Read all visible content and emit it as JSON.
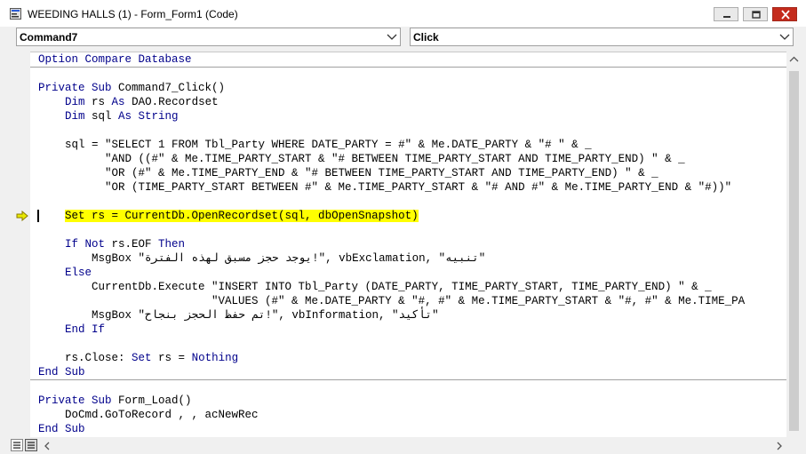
{
  "window": {
    "title": "WEEDING HALLS (1) - Form_Form1 (Code)"
  },
  "object_combo": {
    "value": "Command7"
  },
  "procedure_combo": {
    "value": "Click"
  },
  "code": {
    "declarations": [
      [
        {
          "t": "Option Compare Database",
          "k": true
        }
      ]
    ],
    "proc1": [
      [
        {
          "t": "Private Sub",
          "k": true
        },
        {
          "t": " Command7_Click()"
        }
      ],
      [
        {
          "t": "    "
        },
        {
          "t": "Dim",
          "k": true
        },
        {
          "t": " rs "
        },
        {
          "t": "As",
          "k": true
        },
        {
          "t": " DAO.Recordset"
        }
      ],
      [
        {
          "t": "    "
        },
        {
          "t": "Dim",
          "k": true
        },
        {
          "t": " sql "
        },
        {
          "t": "As String",
          "k": true
        }
      ],
      [
        {
          "t": ""
        }
      ],
      [
        {
          "t": "    sql = \"SELECT 1 FROM Tbl_Party WHERE DATE_PARTY = #\" & Me.DATE_PARTY & \"# \" & _"
        }
      ],
      [
        {
          "t": "          \"AND ((#\" & Me.TIME_PARTY_START & \"# BETWEEN TIME_PARTY_START AND TIME_PARTY_END) \" & _"
        }
      ],
      [
        {
          "t": "          \"OR (#\" & Me.TIME_PARTY_END & \"# BETWEEN TIME_PARTY_START AND TIME_PARTY_END) \" & _"
        }
      ],
      [
        {
          "t": "          \"OR (TIME_PARTY_START BETWEEN #\" & Me.TIME_PARTY_START & \"# AND #\" & Me.TIME_PARTY_END & \"#))\""
        }
      ],
      [
        {
          "t": ""
        }
      ],
      [
        {
          "t": "    "
        },
        {
          "t": "Set rs = CurrentDb.OpenRecordset(sql, dbOpenSnapshot)",
          "h": true
        }
      ],
      [
        {
          "t": ""
        }
      ],
      [
        {
          "t": "    "
        },
        {
          "t": "If Not",
          "k": true
        },
        {
          "t": " rs.EOF "
        },
        {
          "t": "Then",
          "k": true
        }
      ],
      [
        {
          "t": "        MsgBox \"يوجد حجز مسبق لهذه الفترة!\", vbExclamation, \"تنبيه\""
        }
      ],
      [
        {
          "t": "    "
        },
        {
          "t": "Else",
          "k": true
        }
      ],
      [
        {
          "t": "        CurrentDb.Execute \"INSERT INTO Tbl_Party (DATE_PARTY, TIME_PARTY_START, TIME_PARTY_END) \" & _"
        }
      ],
      [
        {
          "t": "                          \"VALUES (#\" & Me.DATE_PARTY & \"#, #\" & Me.TIME_PARTY_START & \"#, #\" & Me.TIME_PA"
        }
      ],
      [
        {
          "t": "        MsgBox \"تم حفظ الحجز بنجاح!\", vbInformation, \"تأكيد\""
        }
      ],
      [
        {
          "t": "    "
        },
        {
          "t": "End If",
          "k": true
        }
      ],
      [
        {
          "t": ""
        }
      ],
      [
        {
          "t": "    rs.Close: "
        },
        {
          "t": "Set",
          "k": true
        },
        {
          "t": " rs = "
        },
        {
          "t": "Nothing",
          "k": true
        }
      ],
      [
        {
          "t": "End Sub",
          "k": true
        }
      ]
    ],
    "proc2": [
      [
        {
          "t": "Private Sub",
          "k": true
        },
        {
          "t": " Form_Load()"
        }
      ],
      [
        {
          "t": "    DoCmd.GoToRecord , , acNewRec"
        }
      ],
      [
        {
          "t": "End Sub",
          "k": true
        }
      ]
    ]
  },
  "colors": {
    "keyword": "#00008b",
    "highlight": "#ffff00",
    "execution_arrow": "#e8e800"
  }
}
